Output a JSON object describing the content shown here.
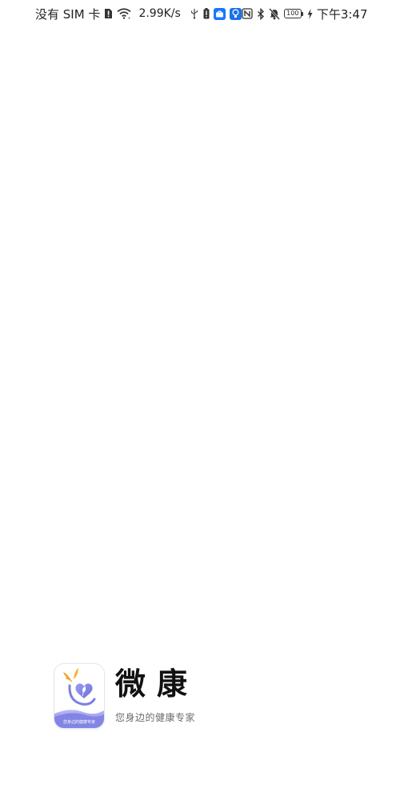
{
  "status_bar": {
    "carrier": "没有 SIM 卡",
    "speed": "2.99K/s",
    "battery": "100",
    "time": "下午3:47",
    "icons": [
      "sim-alert-icon",
      "wifi-icon",
      "usb-icon",
      "battery-alert-icon",
      "blue-app-icon",
      "lightbulb-app-icon",
      "nfc-icon",
      "bluetooth-icon",
      "mute-bell-icon",
      "battery-icon",
      "charging-icon"
    ]
  },
  "brand": {
    "name": "微康",
    "slogan": "您身边的健康专家",
    "icon_caption": "您身边的健康专家",
    "colors": {
      "heart_blue": "#7b7fe0",
      "leaf_orange": "#f0a020",
      "wave_purple": "#8f8ee8"
    }
  }
}
